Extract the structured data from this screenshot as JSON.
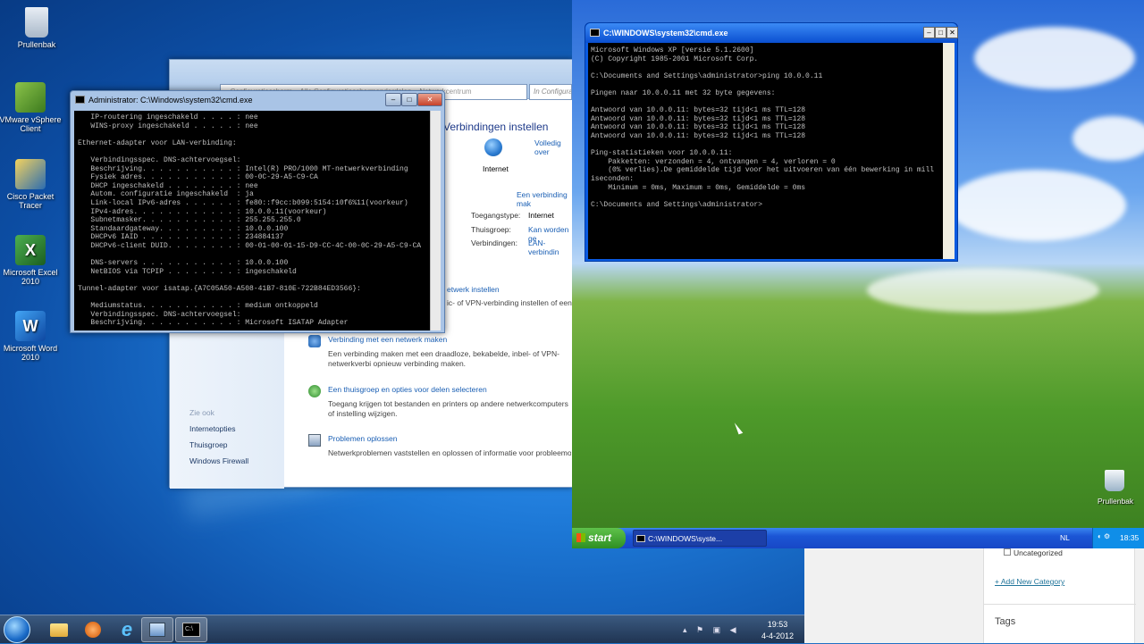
{
  "win7": {
    "desktop_icons": [
      {
        "label": "Prullenbak",
        "icon": "recycle-bin-icon"
      },
      {
        "label": "VMware vSphere Client",
        "icon": "vmware-icon"
      },
      {
        "label": "Cisco Packet Tracer",
        "icon": "packet-tracer-icon"
      },
      {
        "label": "Microsoft Excel 2010",
        "icon": "excel-icon"
      },
      {
        "label": "Microsoft Word 2010",
        "icon": "word-icon"
      }
    ],
    "taskbar": {
      "time": "19:53",
      "date": "4-4-2012"
    }
  },
  "netcenter": {
    "address": "« Configuratiescherm » Alle Configuratieschermonderdelen » Netwerkcentrum",
    "search_placeholder": "In Configuratiesche",
    "heading": "Verbindingen instellen",
    "full_map_link": "Volledig over",
    "internet_label": "Internet",
    "connect_link": "Een verbinding mak",
    "access_type_label": "Toegangstype:",
    "access_type_value": "Internet",
    "homegroup_label": "Thuisgroep:",
    "homegroup_value": "Kan worden ge",
    "connections_label": "Verbindingen:",
    "connections_value": "LAN-verbindin",
    "tasks": [
      {
        "title": "etwerk instellen",
        "desc": "ic- of VPN-verbinding instellen of een rout"
      },
      {
        "title": "Verbinding met een netwerk maken",
        "desc": "Een verbinding maken met een draadloze, bekabelde, inbel- of VPN-netwerkverbi opnieuw verbinding maken."
      },
      {
        "title": "Een thuisgroep en opties voor delen selecteren",
        "desc": "Toegang krijgen tot bestanden en printers op andere netwerkcomputers of instelling wijzigen."
      },
      {
        "title": "Problemen oplossen",
        "desc": "Netwerkproblemen vaststellen en oplossen of informatie voor probleemoplossing za"
      }
    ],
    "see_also": "Zie ook",
    "see_also_items": [
      "Internetopties",
      "Thuisgroep",
      "Windows Firewall"
    ]
  },
  "cmd7": {
    "title": "Administrator: C:\\Windows\\system32\\cmd.exe",
    "output": "   IP-routering ingeschakeld . . . . : nee\n   WINS-proxy ingeschakeld . . . . . : nee\n\nEthernet-adapter voor LAN-verbinding:\n\n   Verbindingsspec. DNS-achtervoegsel:\n   Beschrijving. . . . . . . . . . . : Intel(R) PRO/1000 MT-netwerkverbinding\n   Fysiek adres. . . . . . . . . . . : 00-0C-29-A5-C9-CA\n   DHCP ingeschakeld . . . . . . . . : nee\n   Autom. configuratie ingeschakeld  : ja\n   Link-local IPv6-adres . . . . . . : fe80::f9cc:b099:5154:10f6%11(voorkeur)\n   IPv4-adres. . . . . . . . . . . . : 10.0.0.11(voorkeur)\n   Subnetmasker. . . . . . . . . . . : 255.255.255.0\n   Standaardgateway. . . . . . . . . : 10.0.0.100\n   DHCPv6 IAID . . . . . . . . . . . : 234884137\n   DHCPv6-client DUID. . . . . . . . : 00-01-00-01-15-D9-CC-4C-00-0C-29-A5-C9-CA\n\n   DNS-servers . . . . . . . . . . . : 10.0.0.100\n   NetBIOS via TCPIP . . . . . . . . : ingeschakeld\n\nTunnel-adapter voor isatap.{A7C05A50-A508-41B7-810E-722B84ED3566}:\n\n   Mediumstatus. . . . . . . . . . . : medium ontkoppeld\n   Verbindingsspec. DNS-achtervoegsel:\n   Beschrijving. . . . . . . . . . . : Microsoft ISATAP Adapter"
  },
  "xp": {
    "cmd_title": "C:\\WINDOWS\\system32\\cmd.exe",
    "cmd_output": "Microsoft Windows XP [versie 5.1.2600]\n(C) Copyright 1985-2001 Microsoft Corp.\n\nC:\\Documents and Settings\\administrator>ping 10.0.0.11\n\nPingen naar 10.0.0.11 met 32 byte gegevens:\n\nAntwoord van 10.0.0.11: bytes=32 tijd<1 ms TTL=128\nAntwoord van 10.0.0.11: bytes=32 tijd<1 ms TTL=128\nAntwoord van 10.0.0.11: bytes=32 tijd<1 ms TTL=128\nAntwoord van 10.0.0.11: bytes=32 tijd<1 ms TTL=128\n\nPing-statistieken voor 10.0.0.11:\n    Pakketten: verzonden = 4, ontvangen = 4, verloren = 0\n    (0% verlies).De gemiddelde tijd voor het uitvoeren van één bewerking in mill\niseconden:\n    Minimum = 0ms, Maximum = 0ms, Gemiddelde = 0ms\n\nC:\\Documents and Settings\\administrator>",
    "desktop_icon_label": "Prullenbak",
    "start_label": "start",
    "task_label": "C:\\WINDOWS\\syste...",
    "lang": "NL",
    "time": "18:35"
  },
  "wp": {
    "uncategorized": "Uncategorized",
    "add_category": "+ Add New Category",
    "tags_heading": "Tags"
  }
}
